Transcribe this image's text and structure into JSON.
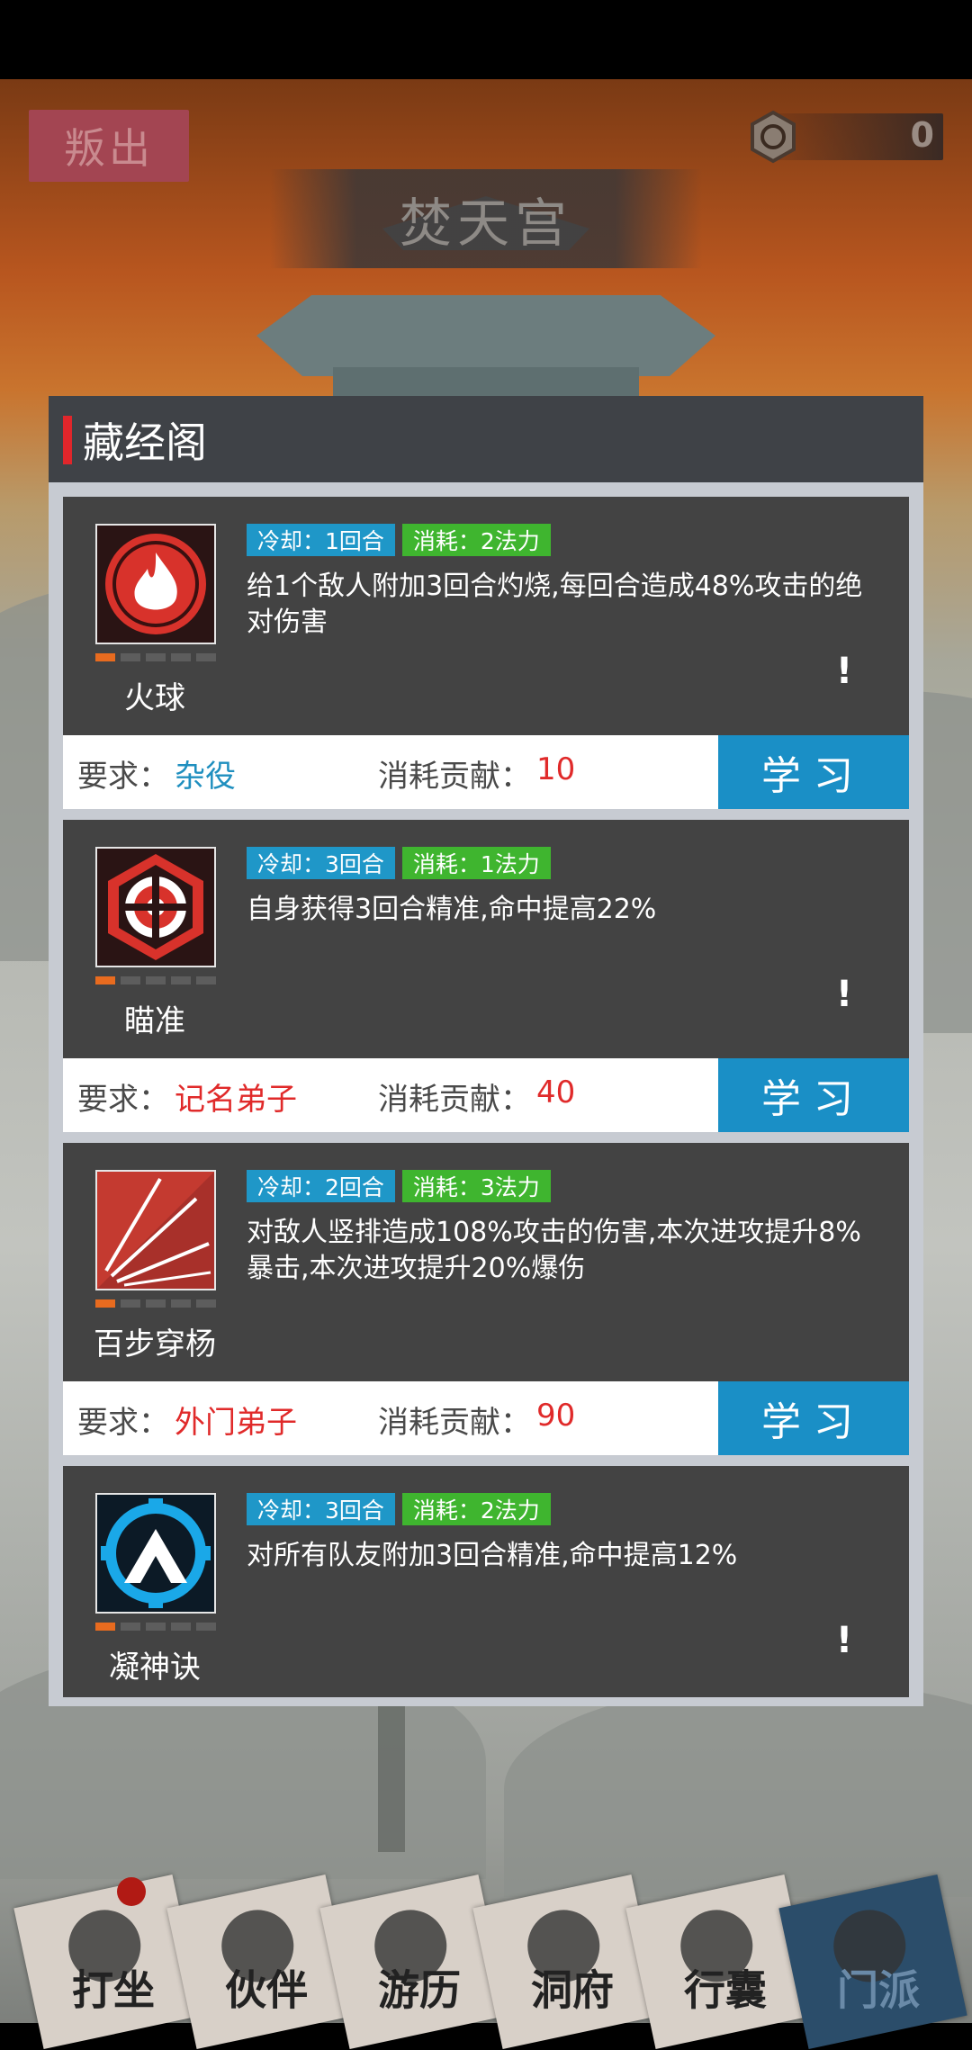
{
  "header": {
    "defect_label": "叛出",
    "currency_value": "0",
    "sect_title": "焚天宫"
  },
  "panel": {
    "title": "藏经阁"
  },
  "skills": [
    {
      "name": "火球",
      "icon": "fireball-icon",
      "cooldown": "冷却：1回合",
      "cost": "消耗：2法力",
      "description": "给1个敌人附加3回合灼烧,每回合造成48%攻击的绝对伤害",
      "requirement_label": "要求：",
      "requirement": "杂役",
      "contribution_label": "消耗贡献：",
      "contribution": "10",
      "learn_label": "学习",
      "level": 1,
      "level_max": 5
    },
    {
      "name": "瞄准",
      "icon": "aim-icon",
      "cooldown": "冷却：3回合",
      "cost": "消耗：1法力",
      "description": "自身获得3回合精准,命中提高22%",
      "requirement_label": "要求：",
      "requirement": "记名弟子",
      "contribution_label": "消耗贡献：",
      "contribution": "40",
      "learn_label": "学习",
      "level": 1,
      "level_max": 5
    },
    {
      "name": "百步穿杨",
      "icon": "arrows-icon",
      "cooldown": "冷却：2回合",
      "cost": "消耗：3法力",
      "description": "对敌人竖排造成108%攻击的伤害,本次进攻提升8%暴击,本次进攻提升20%爆伤",
      "requirement_label": "要求：",
      "requirement": "外门弟子",
      "contribution_label": "消耗贡献：",
      "contribution": "90",
      "learn_label": "学习",
      "level": 1,
      "level_max": 5
    },
    {
      "name": "凝神诀",
      "icon": "focus-icon",
      "cooldown": "冷却：3回合",
      "cost": "消耗：2法力",
      "description": "对所有队友附加3回合精准,命中提高12%",
      "level": 1,
      "level_max": 5
    }
  ],
  "nav": [
    {
      "label": "打坐",
      "icon": "meditate-icon"
    },
    {
      "label": "伙伴",
      "icon": "companion-icon"
    },
    {
      "label": "游历",
      "icon": "travel-icon"
    },
    {
      "label": "洞府",
      "icon": "cave-icon"
    },
    {
      "label": "行囊",
      "icon": "bag-icon"
    },
    {
      "label": "门派",
      "icon": "sect-icon"
    }
  ],
  "colors": {
    "accent_blue": "#1a8fc6",
    "cooldown_tag": "#1f97c8",
    "cost_tag": "#3fb52f",
    "requirement_red": "#e02a2a",
    "requirement_blue": "#1f8fbf"
  }
}
